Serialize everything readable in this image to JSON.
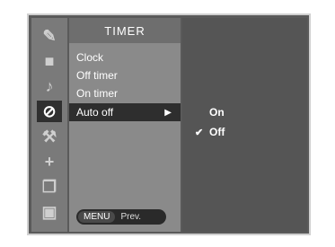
{
  "menu": {
    "title": "TIMER",
    "items": [
      {
        "label": "Clock"
      },
      {
        "label": "Off timer"
      },
      {
        "label": "On timer"
      },
      {
        "label": "Auto off",
        "arrow": "▶"
      }
    ]
  },
  "submenu": {
    "options": [
      {
        "label": "On",
        "check": ""
      },
      {
        "label": "Off",
        "check": "✔"
      }
    ]
  },
  "footer": {
    "key": "MENU",
    "action": "Prev."
  },
  "icons": [
    "picture-icon",
    "screen-icon",
    "audio-icon",
    "time-icon",
    "option-icon",
    "setup-icon",
    "input-icon",
    "lock-icon"
  ]
}
